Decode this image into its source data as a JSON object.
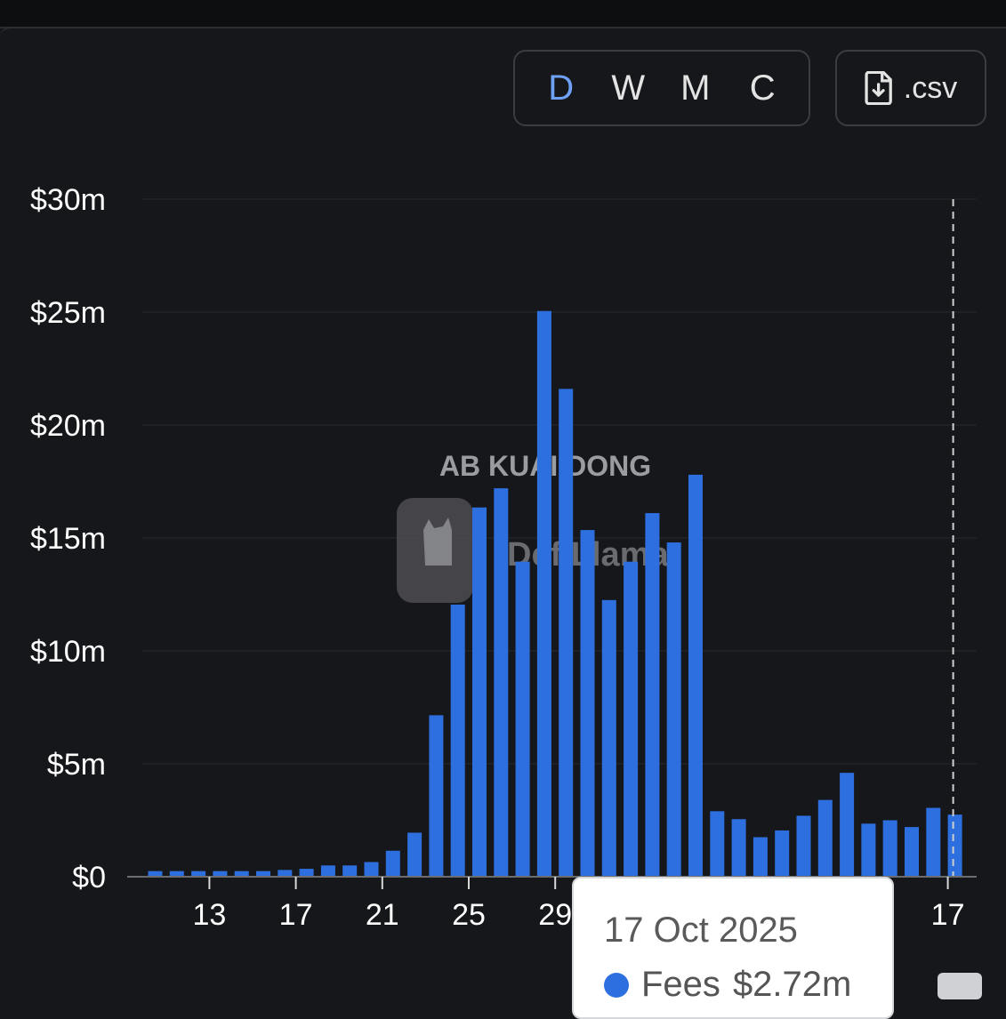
{
  "periods": [
    {
      "label": "D",
      "active": true
    },
    {
      "label": "W",
      "active": false
    },
    {
      "label": "M",
      "active": false
    },
    {
      "label": "C",
      "active": false
    }
  ],
  "csv_label": ".csv",
  "watermarks": {
    "top": "AB KUAI DONG",
    "logo_text": "DefiLlama"
  },
  "tooltip": {
    "date": "17 Oct 2025",
    "series_label": "Fees",
    "value": "$2.72m"
  },
  "colors": {
    "bar": "#2e6fe0",
    "active_period": "#6ea1f5",
    "background": "#16171a"
  },
  "chart_data": {
    "type": "bar",
    "title": "",
    "xlabel": "",
    "ylabel": "",
    "ylim": [
      0,
      30
    ],
    "y_unit": "$m",
    "yticks": [
      {
        "value": 0,
        "label": "$0"
      },
      {
        "value": 5,
        "label": "$5m"
      },
      {
        "value": 10,
        "label": "$10m"
      },
      {
        "value": 15,
        "label": "$15m"
      },
      {
        "value": 20,
        "label": "$20m"
      },
      {
        "value": 25,
        "label": "$25m"
      },
      {
        "value": 30,
        "label": "$30m"
      }
    ],
    "xticks": [
      {
        "index": 3,
        "label": "13"
      },
      {
        "index": 7,
        "label": "17"
      },
      {
        "index": 11,
        "label": "21"
      },
      {
        "index": 15,
        "label": "25"
      },
      {
        "index": 19,
        "label": "29"
      },
      {
        "index": 37,
        "label": "17"
      }
    ],
    "values": [
      0.25,
      0.25,
      0.25,
      0.25,
      0.25,
      0.25,
      0.3,
      0.35,
      0.5,
      0.5,
      0.65,
      1.15,
      1.95,
      7.15,
      12.05,
      16.35,
      17.2,
      13.95,
      25.05,
      21.6,
      15.35,
      12.25,
      13.95,
      16.1,
      14.8,
      17.8,
      2.9,
      2.55,
      1.75,
      2.05,
      2.7,
      3.4,
      4.6,
      2.35,
      2.5,
      2.2,
      3.05,
      2.75
    ],
    "highlight_index": 37,
    "grid": true,
    "legend": "none"
  }
}
